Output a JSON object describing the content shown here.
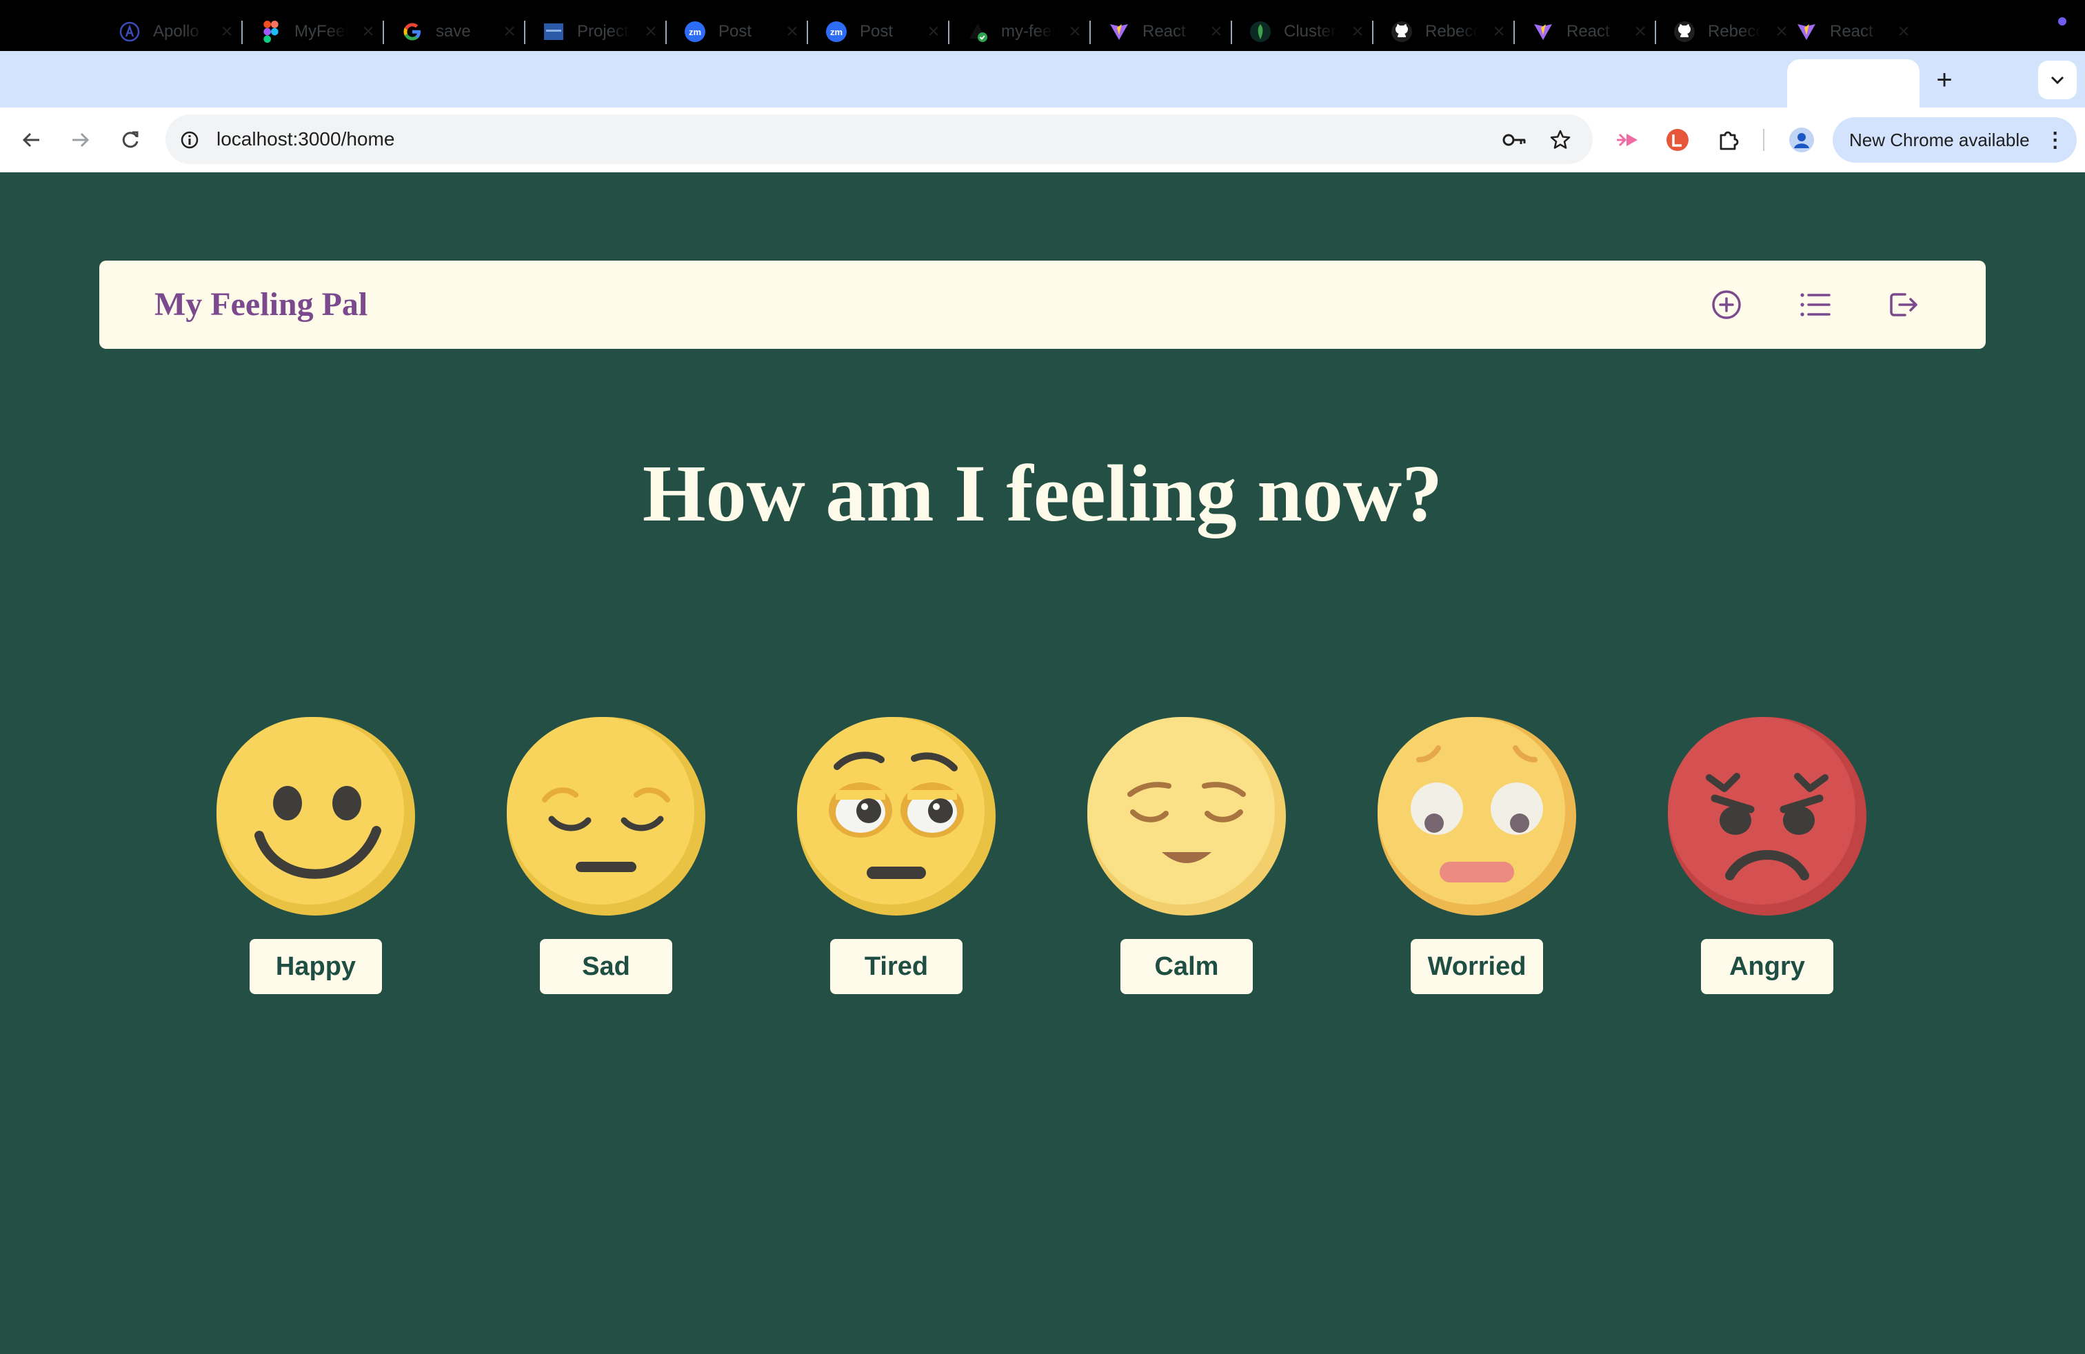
{
  "browser": {
    "tabs": [
      {
        "title": "Apollo",
        "icon": "apollo-icon"
      },
      {
        "title": "MyFeeling",
        "icon": "figma-icon"
      },
      {
        "title": "save",
        "icon": "google-icon"
      },
      {
        "title": "Project",
        "icon": "project-icon"
      },
      {
        "title": "Post",
        "icon": "zoom-icon"
      },
      {
        "title": "Post",
        "icon": "zoom-icon"
      },
      {
        "title": "my-feeling",
        "icon": "vercel-check-icon"
      },
      {
        "title": "React",
        "icon": "vite-icon"
      },
      {
        "title": "Cluster",
        "icon": "mongodb-icon"
      },
      {
        "title": "Rebecca",
        "icon": "github-icon"
      },
      {
        "title": "React",
        "icon": "vite-icon"
      },
      {
        "title": "Rebecca",
        "icon": "github-icon"
      },
      {
        "title": "React",
        "icon": "vite-icon"
      }
    ],
    "active_tab_index": 12,
    "url": "localhost:3000/home",
    "update_button": "New Chrome available"
  },
  "app": {
    "brand": "My Feeling Pal",
    "nav_icons": [
      "add-circle-icon",
      "list-icon",
      "logout-icon"
    ],
    "heading": "How am I feeling now?",
    "moods": [
      {
        "label": "Happy",
        "icon": "happy-face-icon",
        "color": "#f8d45c"
      },
      {
        "label": "Sad",
        "icon": "sad-face-icon",
        "color": "#f8d45c"
      },
      {
        "label": "Tired",
        "icon": "tired-face-icon",
        "color": "#f8d45c"
      },
      {
        "label": "Calm",
        "icon": "calm-face-icon",
        "color": "#fae187"
      },
      {
        "label": "Worried",
        "icon": "worried-face-icon",
        "color": "#f8d36c"
      },
      {
        "label": "Angry",
        "icon": "angry-face-icon",
        "color": "#d55050"
      }
    ]
  },
  "colors": {
    "page_background": "#234f45",
    "navbar_background": "#fefbea",
    "brand_text": "#7b4a8e",
    "nav_icon": "#7b4a8e",
    "button_text": "#1f4e43"
  }
}
